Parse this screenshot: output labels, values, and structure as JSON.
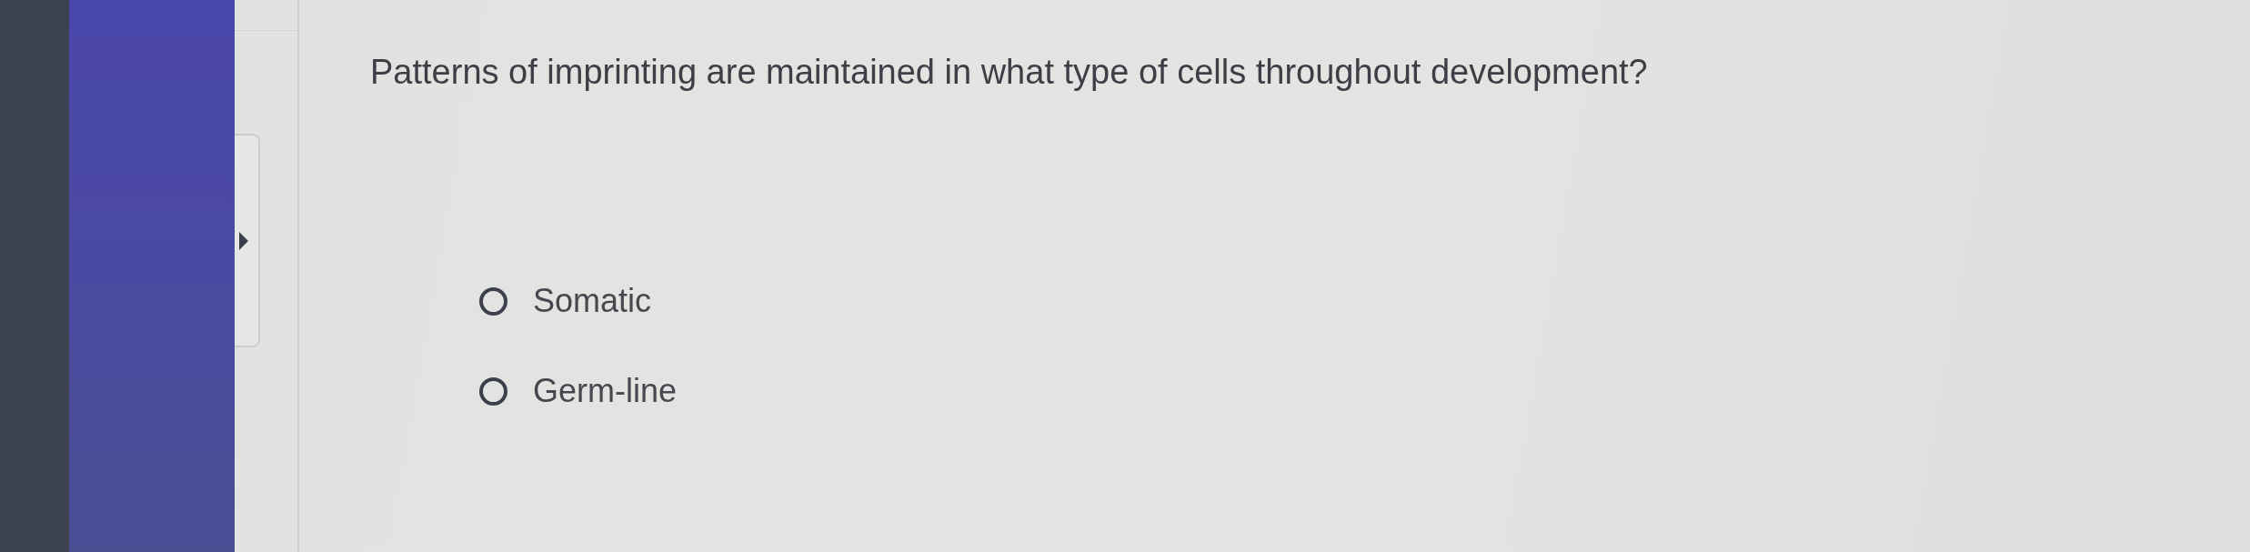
{
  "question": {
    "text": "Patterns of imprinting are maintained in what type of cells throughout development?"
  },
  "options": [
    {
      "label": "Somatic",
      "selected": false
    },
    {
      "label": "Germ-line",
      "selected": false
    }
  ]
}
